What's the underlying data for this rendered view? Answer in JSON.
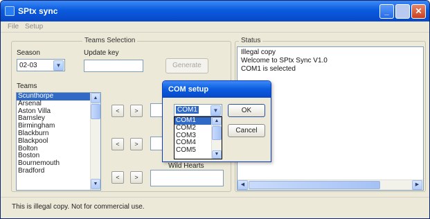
{
  "window": {
    "title": "SPtx sync"
  },
  "menu": [
    "File",
    "Setup"
  ],
  "teams_selection": {
    "group_label": "Teams Selection",
    "season_label": "Season",
    "season_value": "02-03",
    "update_key_label": "Update key",
    "update_key_value": "",
    "generate_button": "Generate",
    "teams_label": "Teams",
    "teams": [
      "Arsenal",
      "Aston Villa",
      "Barnsley",
      "Birmingham",
      "Blackburn",
      "Blackpool",
      "Bolton",
      "Boston",
      "Bournemouth",
      "Bradford"
    ],
    "selected_team": "Scunthorpe",
    "move_buttons": [
      "<",
      ">"
    ],
    "bottom_slot_label": "Wild Hearts"
  },
  "status": {
    "group_label": "Status",
    "lines": [
      "Illegal copy",
      "Welcome to SPtx Sync V1.0",
      " COM1 is selected"
    ]
  },
  "statusbar": {
    "text": "This is illegal copy. Not for commercial use."
  },
  "com_dialog": {
    "title": "COM setup",
    "combo_value": "COM1",
    "ok_button": "OK",
    "cancel_button": "Cancel",
    "options": [
      "COM1",
      "COM2",
      "COM3",
      "COM4",
      "COM5"
    ]
  },
  "colors": {
    "title_blue": "#0a5bde",
    "selection_blue": "#316ac5",
    "window_bg": "#ece9d8"
  }
}
